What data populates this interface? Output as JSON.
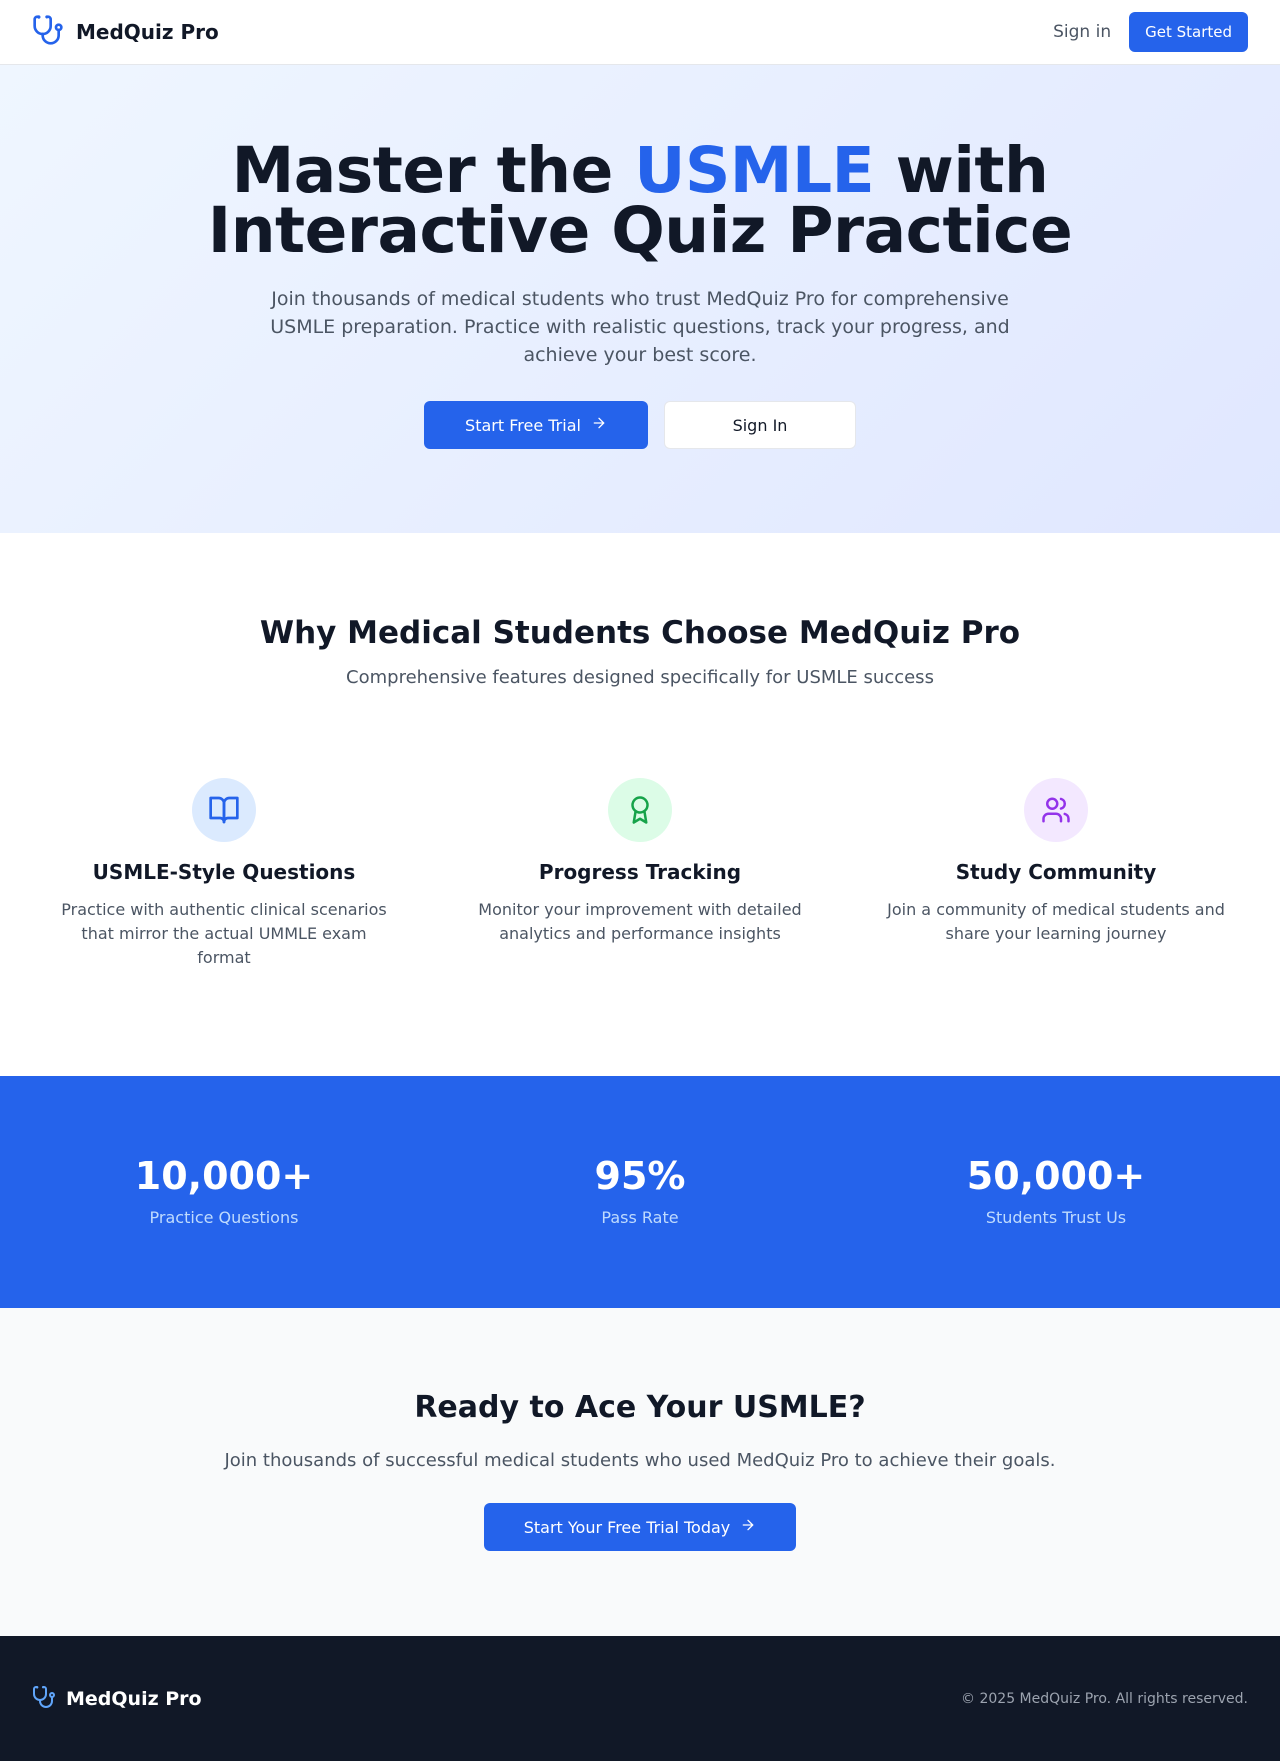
{
  "header": {
    "brand": "MedQuiz Pro",
    "brand_icon": "stethoscope-icon",
    "sign_in": "Sign in",
    "get_started": "Get Started"
  },
  "hero": {
    "title_prefix": "Master the ",
    "title_accent": "USMLE",
    "title_suffix": " with",
    "title_line2": "Interactive Quiz Practice",
    "subtitle": "Join thousands of medical students who trust MedQuiz Pro for comprehensive USMLE preparation. Practice with realistic questions, track your progress, and achieve your best score.",
    "primary_button": "Start Free Trial",
    "secondary_button": "Sign In"
  },
  "features": {
    "title": "Why Medical Students Choose MedQuiz Pro",
    "subtitle": "Comprehensive features designed specifically for USMLE success",
    "items": [
      {
        "icon": "book-open-icon",
        "title": "USMLE-Style Questions",
        "description": "Practice with authentic clinical scenarios that mirror the actual UMMLE exam format"
      },
      {
        "icon": "award-icon",
        "title": "Progress Tracking",
        "description": "Monitor your improvement with detailed analytics and performance insights"
      },
      {
        "icon": "users-icon",
        "title": "Study Community",
        "description": "Join a community of medical students and share your learning journey"
      }
    ]
  },
  "stats": [
    {
      "value": "10,000+",
      "label": "Practice Questions"
    },
    {
      "value": "95%",
      "label": "Pass Rate"
    },
    {
      "value": "50,000+",
      "label": "Students Trust Us"
    }
  ],
  "cta": {
    "title": "Ready to Ace Your USMLE?",
    "subtitle": "Join thousands of successful medical students who used MedQuiz Pro to achieve their goals.",
    "button": "Start Your Free Trial Today"
  },
  "footer": {
    "brand": "MedQuiz Pro",
    "copyright": "© 2025 MedQuiz Pro. All rights reserved."
  },
  "colors": {
    "primary": "#2563eb",
    "dark": "#111827",
    "feature_blue_bg": "#dbeafe",
    "feature_green_bg": "#dcfce7",
    "feature_purple_bg": "#f3e8ff"
  }
}
